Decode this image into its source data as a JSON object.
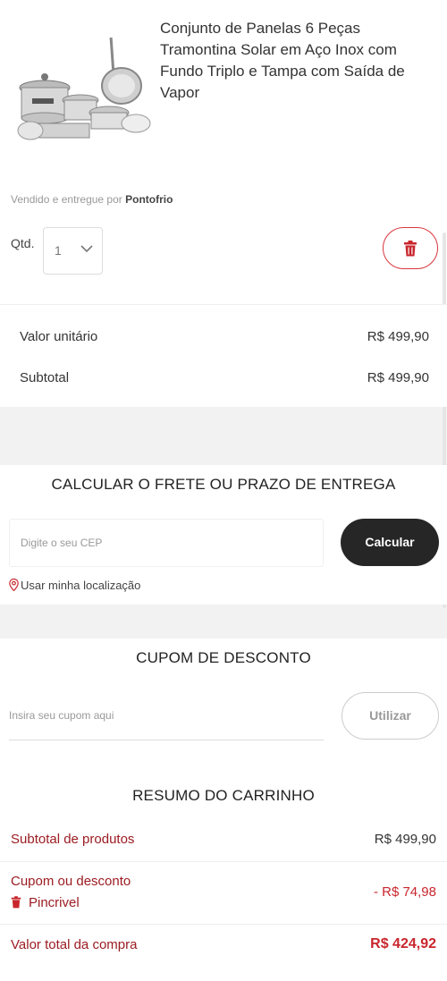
{
  "product": {
    "title": "Conjunto de Panelas 6 Peças Tramontina Solar em Aço Inox com Fundo Triplo e Tampa com Saída de Vapor",
    "seller_prefix": "Vendido e entregue por",
    "seller_name": "Pontofrio",
    "qty_label": "Qtd.",
    "qty_value": "1"
  },
  "prices": {
    "unit_label": "Valor unitário",
    "unit_value": "R$ 499,90",
    "subtotal_label": "Subtotal",
    "subtotal_value": "R$ 499,90"
  },
  "frete": {
    "title": "CALCULAR O FRETE OU PRAZO DE ENTREGA",
    "cep_placeholder": "Digite o seu CEP",
    "calc_button": "Calcular",
    "location_link": "Usar minha localização"
  },
  "cupom": {
    "title": "CUPOM DE DESCONTO",
    "placeholder": "Insira seu cupom aqui",
    "button": "Utilizar"
  },
  "resumo": {
    "title": "RESUMO DO CARRINHO",
    "subtotal_label": "Subtotal de produtos",
    "subtotal_value": "R$ 499,90",
    "coupon_label": "Cupom ou desconto",
    "coupon_code": "Pincrivel",
    "coupon_value": "- R$ 74,98",
    "total_label": "Valor total da compra",
    "total_value": "R$ 424,92"
  },
  "colors": {
    "accent": "#c8262c",
    "dark_button": "#262626"
  }
}
